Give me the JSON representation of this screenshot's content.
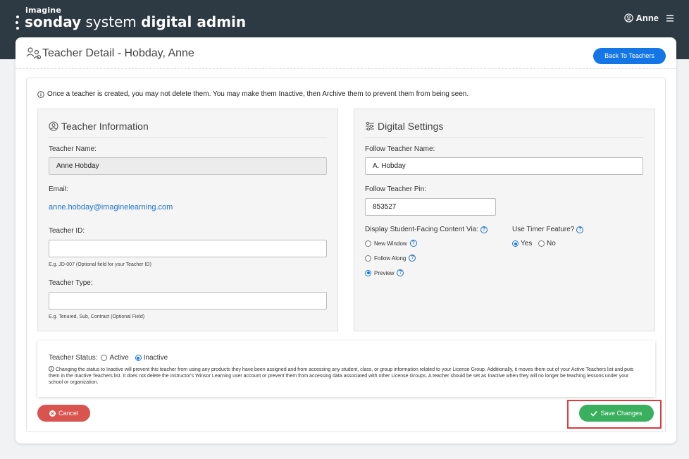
{
  "header": {
    "brand_small": "imagine",
    "brand_word1": "sonday",
    "brand_word2": "system",
    "brand_word3": "digital admin",
    "user_name": "Anne"
  },
  "page": {
    "title": "Teacher Detail - Hobday, Anne",
    "back_button": "Back To Teachers",
    "notice": "Once a teacher is created, you may not delete them. You may make them Inactive, then Archive them to prevent them from being seen."
  },
  "teacher_info": {
    "title": "Teacher Information",
    "name_label": "Teacher Name:",
    "name_value": "Anne Hobday",
    "email_label": "Email:",
    "email_value": "anne.hobday@imaginelearning.com",
    "id_label": "Teacher ID:",
    "id_value": "",
    "id_hint": "E.g. JD-007 (Optional field for your Teacher ID)",
    "type_label": "Teacher Type:",
    "type_value": "",
    "type_hint": "E.g. Tenured, Sub, Contract (Optional Field)"
  },
  "digital_settings": {
    "title": "Digital Settings",
    "follow_name_label": "Follow Teacher Name:",
    "follow_name_value": "A. Hobday",
    "follow_pin_label": "Follow Teacher Pin:",
    "follow_pin_value": "853527",
    "display_label": "Display Student-Facing Content Via:",
    "display_options": [
      "New Window",
      "Follow Along",
      "Preview"
    ],
    "display_selected": "Preview",
    "timer_label": "Use Timer Feature?",
    "timer_options": [
      "Yes",
      "No"
    ],
    "timer_selected": "Yes"
  },
  "status": {
    "label": "Teacher Status:",
    "options": [
      "Active",
      "Inactive"
    ],
    "selected": "Inactive",
    "note": "Changing the status to Inactive will prevent this teacher from using any products they have been assigned and from accessing any student, class, or group information related to your License Group. Additionally, it moves them out of your Active Teachers list and puts them in the Inactive Teachers list. It does not delete the instructor's Winsor Learning user account or prevent them from accessing data associated with other License Groups. A teacher should be set as Inactive when they will no longer be teaching lessons under your school or organization."
  },
  "actions": {
    "cancel": "Cancel",
    "save": "Save Changes"
  },
  "colors": {
    "topbar": "#2d3943",
    "primary": "#1476e6",
    "cancel": "#d9534f",
    "save": "#3aaf5d",
    "highlight": "#e0393e"
  }
}
